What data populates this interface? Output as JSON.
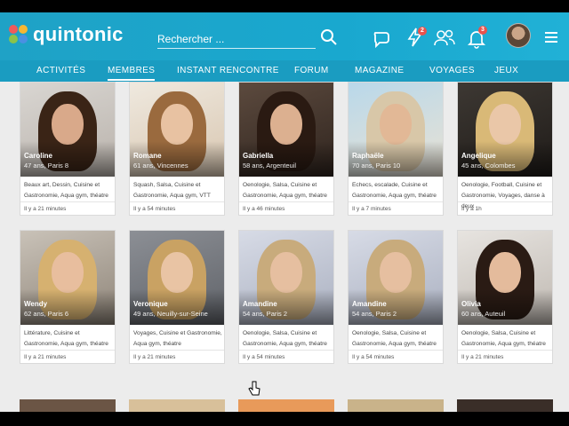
{
  "app": {
    "brand": "quintonic",
    "accent": "#1fa2c6"
  },
  "search": {
    "placeholder": "Rechercher ..."
  },
  "header_icons": [
    {
      "name": "chat-icon",
      "badge": ""
    },
    {
      "name": "flash-icon",
      "badge": "2"
    },
    {
      "name": "users-icon",
      "badge": ""
    },
    {
      "name": "bell-icon",
      "badge": "3"
    }
  ],
  "nav": [
    {
      "label": "Activités",
      "active": false
    },
    {
      "label": "Membres",
      "active": true
    },
    {
      "label": "Instant Rencontre",
      "active": false
    },
    {
      "label": "Forum",
      "active": false
    },
    {
      "label": "Magazine",
      "active": false
    },
    {
      "label": "Voyages",
      "active": false
    },
    {
      "label": "Jeux",
      "active": false
    }
  ],
  "members": [
    {
      "name": "Caroline",
      "info": "47 ans, Paris 8",
      "interests": "Beaux art, Dessin, Cuisine et Gastronomie, Aqua gym, théatre",
      "time": "Il y a 21 minutes"
    },
    {
      "name": "Romane",
      "info": "61 ans, Vincennes",
      "interests": "Squash, Salsa, Cuisine et Gastronomie, Aqua gym, VTT",
      "time": "Il y a 54 minutes"
    },
    {
      "name": "Gabriella",
      "info": "58 ans, Argenteuil",
      "interests": "Oenologie, Salsa, Cuisine et Gastronomie, Aqua gym, théatre",
      "time": "Il y a 46 minutes"
    },
    {
      "name": "Raphaële",
      "info": "70 ans, Paris 10",
      "interests": "Echecs, escalade, Cuisine et Gastronomie, Aqua gym, théatre",
      "time": "Il y a 7 minutes"
    },
    {
      "name": "Angelique",
      "info": "45 ans, Colombes",
      "interests": "Oenologie, Football, Cuisine et Gastronomie, Voyages, danse à deux",
      "time": "Il y a 1h"
    },
    {
      "name": "Wendy",
      "info": "62 ans, Paris 6",
      "interests": "Littérature, Cuisine et Gastronomie, Aqua gym, théatre",
      "time": "Il y a 21 minutes"
    },
    {
      "name": "Veronique",
      "info": "49 ans, Neuilly-sur-Seine",
      "interests": "Voyages, Cuisine et Gastronomie, Aqua gym, théatre",
      "time": "Il y a 21 minutes"
    },
    {
      "name": "Amandine",
      "info": "54 ans, Paris 2",
      "interests": "Oenologie, Salsa, Cuisine et Gastronomie, Aqua gym, théatre",
      "time": "Il y a 54 minutes"
    },
    {
      "name": "Amandine",
      "info": "54 ans, Paris 2",
      "interests": "Oenologie, Salsa, Cuisine et Gastronomie, Aqua gym, théatre",
      "time": "Il y a 54 minutes"
    },
    {
      "name": "Olivia",
      "info": "60 ans, Auteuil",
      "interests": "Oenologie, Salsa, Cuisine et Gastronomie, Aqua gym, théatre",
      "time": "Il y a 21 minutes"
    }
  ]
}
